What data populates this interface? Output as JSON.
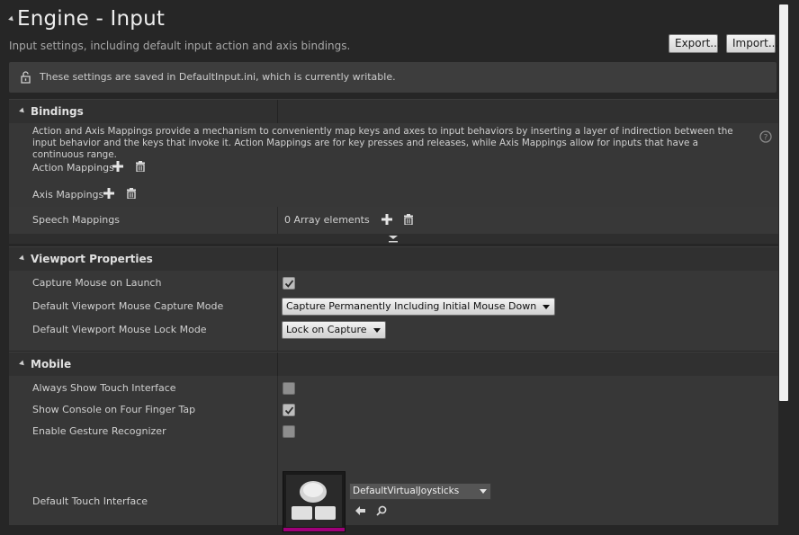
{
  "header": {
    "title": "Engine - Input",
    "subtitle": "Input settings, including default input action and axis bindings.",
    "export_label": "Export...",
    "import_label": "Import..."
  },
  "notice": {
    "text": "These settings are saved in DefaultInput.ini, which is currently writable.",
    "icon": "unlock-icon"
  },
  "bindings": {
    "title": "Bindings",
    "description": "Action and Axis Mappings provide a mechanism to conveniently map keys and axes to input behaviors by inserting a layer of indirection between the input behavior and the keys that invoke it. Action Mappings are for key presses and releases, while Axis Mappings allow for inputs that have a continuous range.",
    "action_mappings": "Action Mappings",
    "axis_mappings": "Axis Mappings",
    "speech_mappings": "Speech Mappings",
    "speech_value": "0 Array elements"
  },
  "viewport": {
    "title": "Viewport Properties",
    "capture_mouse_label": "Capture Mouse on Launch",
    "capture_mouse_checked": true,
    "capture_mode_label": "Default Viewport Mouse Capture Mode",
    "capture_mode_value": "Capture Permanently Including Initial Mouse Down",
    "lock_mode_label": "Default Viewport Mouse Lock Mode",
    "lock_mode_value": "Lock on Capture"
  },
  "mobile": {
    "title": "Mobile",
    "always_show_label": "Always Show Touch Interface",
    "always_show_checked": false,
    "show_console_label": "Show Console on Four Finger Tap",
    "show_console_checked": true,
    "gesture_label": "Enable Gesture Recognizer",
    "gesture_checked": false,
    "touch_interface_label": "Default Touch Interface",
    "touch_interface_value": "DefaultVirtualJoysticks"
  },
  "colors": {
    "background": "#262626",
    "row": "#373737",
    "header": "#303030",
    "asset_accent": "#a0007a"
  }
}
